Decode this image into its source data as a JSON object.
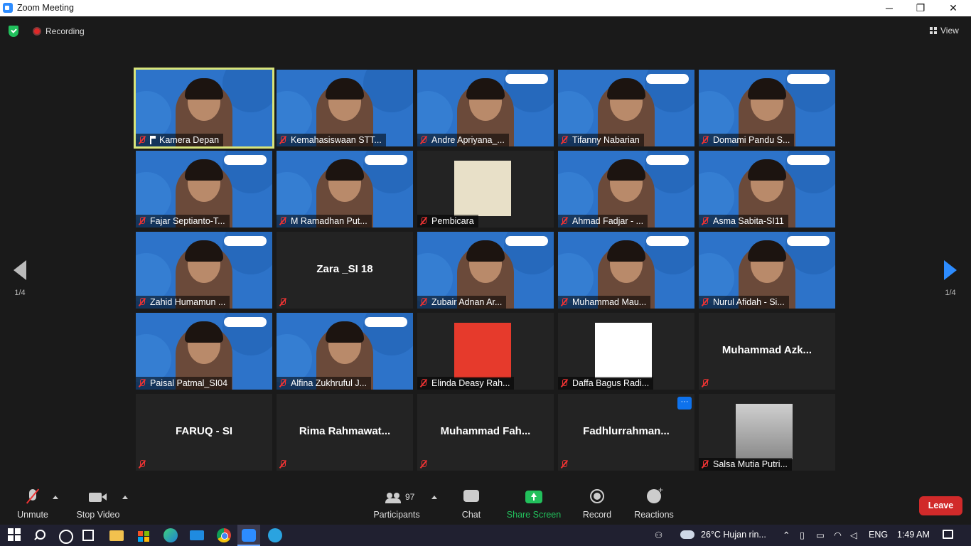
{
  "window": {
    "title": "Zoom Meeting",
    "controls": [
      "─",
      "❐",
      "✕"
    ]
  },
  "topbar": {
    "recording_label": "Recording",
    "view_label": "View"
  },
  "pager": {
    "left_page": "1/4",
    "right_page": "1/4"
  },
  "tiles": [
    {
      "name": "Kamera Depan",
      "kind": "video",
      "active": true,
      "pinned": true
    },
    {
      "name": "Kemahasiswaan STT...",
      "kind": "video"
    },
    {
      "name": "Andre Apriyana_...",
      "kind": "video"
    },
    {
      "name": "Tifanny Nabarian",
      "kind": "video"
    },
    {
      "name": "Domami Pandu S...",
      "kind": "video"
    },
    {
      "name": "Fajar Septianto-T...",
      "kind": "video"
    },
    {
      "name": "M Ramadhan Put...",
      "kind": "video"
    },
    {
      "name": "Pembicara",
      "kind": "photo"
    },
    {
      "name": "Ahmad Fadjar - ...",
      "kind": "video"
    },
    {
      "name": "Asma Sabita-SI11",
      "kind": "video"
    },
    {
      "name": "Zahid Humamun ...",
      "kind": "video"
    },
    {
      "name": "",
      "kind": "name",
      "display_name": "Zara _SI 18"
    },
    {
      "name": "Zubair Adnan Ar...",
      "kind": "video"
    },
    {
      "name": "Muhammad Mau...",
      "kind": "video"
    },
    {
      "name": "Nurul Afidah - Si...",
      "kind": "video"
    },
    {
      "name": "Paisal Patmal_SI04",
      "kind": "video"
    },
    {
      "name": "Alfina Zukhruful J...",
      "kind": "video"
    },
    {
      "name": "Elinda Deasy Rah...",
      "kind": "photo-red"
    },
    {
      "name": "Daffa Bagus Radi...",
      "kind": "photo-white"
    },
    {
      "name": "",
      "kind": "name",
      "display_name": "Muhammad  Azk..."
    },
    {
      "name": "",
      "kind": "name",
      "display_name": "FARUQ - SI"
    },
    {
      "name": "",
      "kind": "name",
      "display_name": "Rima  Rahmawat..."
    },
    {
      "name": "",
      "kind": "name",
      "display_name": "Muhammad  Fah..."
    },
    {
      "name": "",
      "kind": "name",
      "display_name": "Fadhlurrahman...",
      "more": "···"
    },
    {
      "name": "Salsa Mutia Putri...",
      "kind": "photo-mist"
    }
  ],
  "toolbar": {
    "unmute": "Unmute",
    "stop_video": "Stop Video",
    "participants": "Participants",
    "participant_count": "97",
    "chat": "Chat",
    "share_screen": "Share Screen",
    "record": "Record",
    "reactions": "Reactions",
    "leave": "Leave"
  },
  "taskbar": {
    "weather": "26°C  Hujan rin...",
    "language": "ENG",
    "time": "1:49 AM"
  },
  "colors": {
    "accent": "#2d8cff",
    "share_green": "#22c05c",
    "leave_red": "#d12a2a",
    "active_border": "#d8e47a"
  }
}
